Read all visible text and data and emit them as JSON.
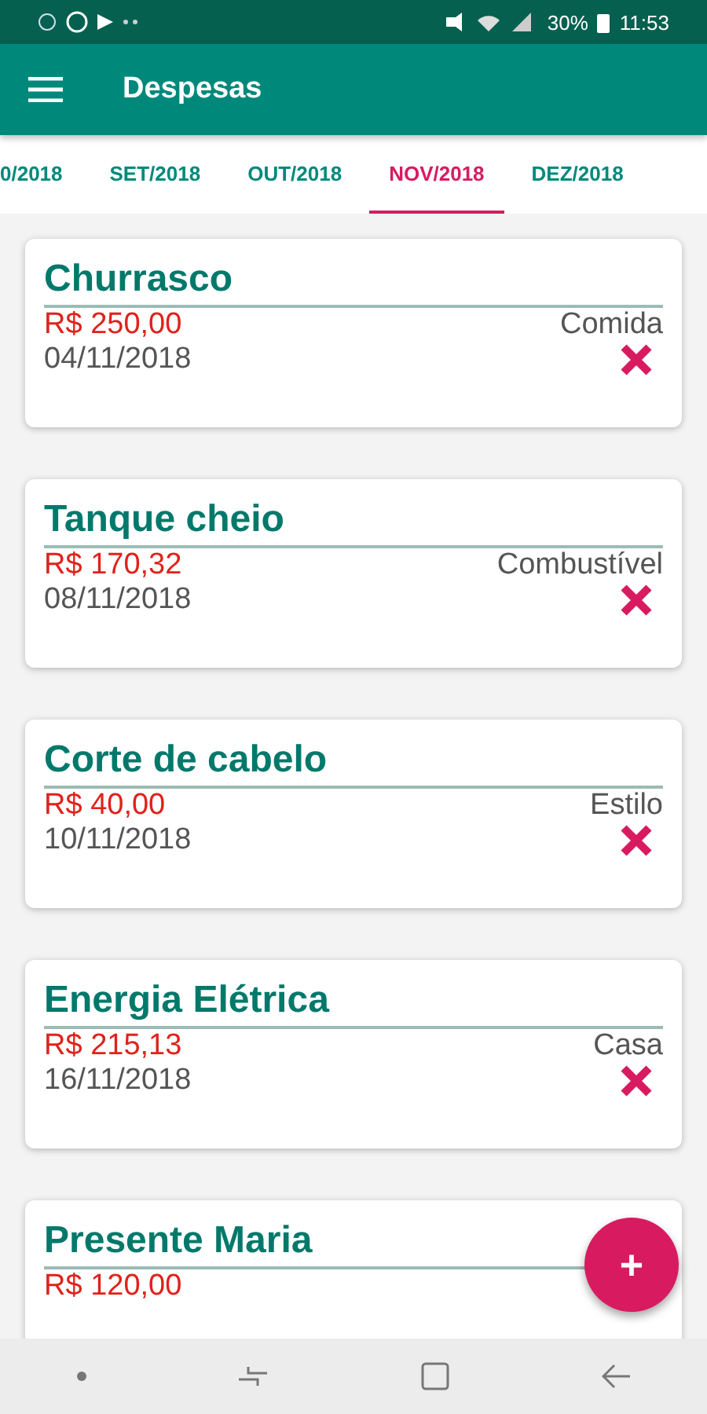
{
  "status_bar": {
    "battery": "30%",
    "time": "11:53"
  },
  "app_bar": {
    "title": "Despesas"
  },
  "tabs": [
    {
      "label": "0/2018",
      "selected": false
    },
    {
      "label": "SET/2018",
      "selected": false
    },
    {
      "label": "OUT/2018",
      "selected": false
    },
    {
      "label": "NOV/2018",
      "selected": true
    },
    {
      "label": "DEZ/2018",
      "selected": false
    }
  ],
  "expenses": [
    {
      "title": "Churrasco",
      "amount": "R$ 250,00",
      "category": "Comida",
      "date": "04/11/2018"
    },
    {
      "title": "Tanque cheio",
      "amount": "R$ 170,32",
      "category": "Combustível",
      "date": "08/11/2018"
    },
    {
      "title": "Corte de cabelo",
      "amount": "R$ 40,00",
      "category": "Estilo",
      "date": "10/11/2018"
    },
    {
      "title": "Energia Elétrica",
      "amount": "R$ 215,13",
      "category": "Casa",
      "date": "16/11/2018"
    },
    {
      "title": "Presente Maria",
      "amount": "R$ 120,00"
    }
  ],
  "fab": {
    "label": "+"
  }
}
